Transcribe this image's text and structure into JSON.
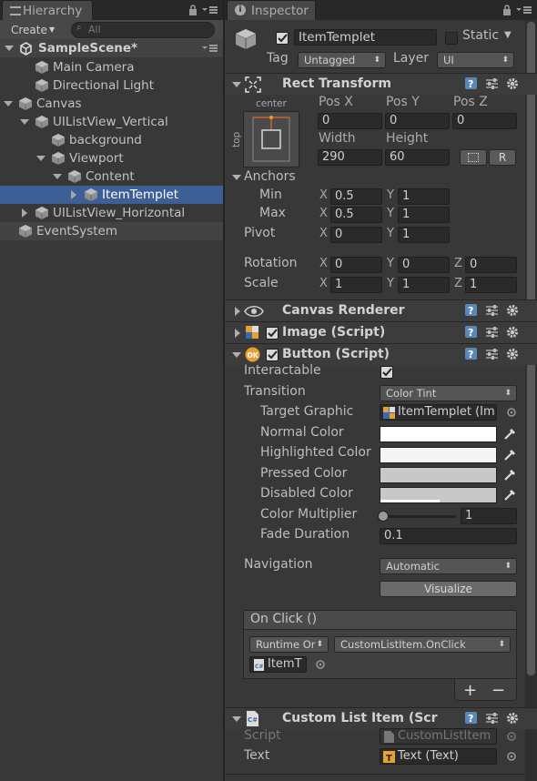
{
  "hierarchy": {
    "tab_label": "Hierarchy",
    "create_label": "Create",
    "search_placeholder": "All",
    "scene": "SampleScene*",
    "items": [
      {
        "label": "Main Camera"
      },
      {
        "label": "Directional Light"
      },
      {
        "label": "Canvas"
      },
      {
        "label": "UIListView_Vertical"
      },
      {
        "label": "background"
      },
      {
        "label": "Viewport"
      },
      {
        "label": "Content"
      },
      {
        "label": "ItemTemplet"
      },
      {
        "label": "UIListView_Horizontal"
      },
      {
        "label": "EventSystem"
      }
    ]
  },
  "inspector": {
    "tab_label": "Inspector",
    "object_name": "ItemTemplet",
    "static_label": "Static",
    "tag_label": "Tag",
    "tag_value": "Untagged",
    "layer_label": "Layer",
    "layer_value": "UI",
    "rect": {
      "title": "Rect Transform",
      "anchor_h": "center",
      "anchor_v": "top",
      "posx_label": "Pos X",
      "posy_label": "Pos Y",
      "posz_label": "Pos Z",
      "posx": "0",
      "posy": "0",
      "posz": "0",
      "width_label": "Width",
      "height_label": "Height",
      "width": "290",
      "height": "60",
      "r_label": "R",
      "anchors_label": "Anchors",
      "min_label": "Min",
      "max_label": "Max",
      "pivot_label": "Pivot",
      "x": "X",
      "y": "Y",
      "z": "Z",
      "min_x": "0.5",
      "min_y": "1",
      "max_x": "0.5",
      "max_y": "1",
      "pivot_x": "0",
      "pivot_y": "1",
      "rotation_label": "Rotation",
      "rot_x": "0",
      "rot_y": "0",
      "rot_z": "0",
      "scale_label": "Scale",
      "scale_x": "1",
      "scale_y": "1",
      "scale_z": "1"
    },
    "canvas_renderer": "Canvas Renderer",
    "image_script": "Image (Script)",
    "button": {
      "title": "Button (Script)",
      "interactable": "Interactable",
      "transition": "Transition",
      "transition_value": "Color Tint",
      "target_graphic": "Target Graphic",
      "target_value": "ItemTemplet (Im",
      "normal": "Normal Color",
      "highlighted": "Highlighted Color",
      "pressed": "Pressed Color",
      "disabled": "Disabled Color",
      "multiplier": "Color Multiplier",
      "multiplier_value": "1",
      "fade": "Fade Duration",
      "fade_value": "0.1",
      "navigation": "Navigation",
      "navigation_value": "Automatic",
      "visualize": "Visualize",
      "onclick": "On Click ()",
      "runtime": "Runtime Or",
      "handler": "CustomListItem.OnClick",
      "object": "ItemT",
      "plus": "+",
      "minus": "−"
    },
    "custom": {
      "title": "Custom List Item (Scr",
      "script_label": "Script",
      "script_value": "CustomListItem",
      "text_label": "Text",
      "text_value": "Text (Text)"
    },
    "colors": {
      "normal": "#ffffff",
      "highlighted": "#f5f5f5",
      "pressed": "#c8c8c8",
      "disabled": "#c8c8c8"
    }
  }
}
